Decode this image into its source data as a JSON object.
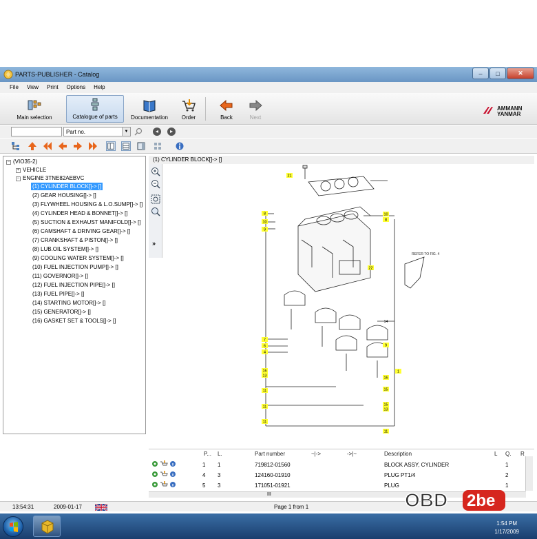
{
  "window": {
    "title": "PARTS-PUBLISHER - Catalog"
  },
  "menu": [
    "File",
    "View",
    "Print",
    "Options",
    "Help"
  ],
  "toolbar": {
    "main_selection": "Main selection",
    "catalogue": "Catalogue of parts",
    "documentation": "Documentation",
    "order": "Order",
    "back": "Back",
    "next": "Next"
  },
  "brand": {
    "line1": "AMMANN",
    "line2": "YANMAR"
  },
  "search": {
    "value": "",
    "field": "Part no."
  },
  "tree": {
    "root": "(VIO35-2)",
    "vehicle": "VEHICLE",
    "engine": "ENGINE 3TNE82AEBVC",
    "items": [
      "(1) CYLINDER BLOCK[]-> []",
      "(2) GEAR HOUSING[]-> []",
      "(3) FLYWHEEL HOUSING & L.O.SUMP[]-> []",
      "(4) CYLINDER HEAD & BONNET[]-> []",
      "(5) SUCTION & EXHAUST MANIFOLD[]-> []",
      "(6) CAMSHAFT & DRIVING GEAR[]-> []",
      "(7) CRANKSHAFT & PISTON[]-> []",
      "(8) LUB.OIL SYSTEM[]-> []",
      "(9) COOLING WATER SYSTEM[]-> []",
      "(10) FUEL INJECTION PUMP[]-> []",
      "(11) GOVERNOR[]-> []",
      "(12) FUEL INJECTION PIPE[]-> []",
      "(13) FUEL PIPE[]-> []",
      "(14) STARTING MOTOR[]-> []",
      "(15) GENERATOR[]-> []",
      "(16) GASKET SET & TOOLS[]-> []"
    ]
  },
  "pane": {
    "title": "(1) CYLINDER BLOCK[]-> []",
    "expand": "»"
  },
  "diagram": {
    "callouts_left": [
      "8",
      "10",
      "9",
      "7",
      "6",
      "4",
      "16",
      "13",
      "11",
      "11",
      "11"
    ],
    "callouts_right": [
      "22",
      "10",
      "8",
      "14",
      "9",
      "1",
      "16",
      "15",
      "15",
      "13",
      "11"
    ],
    "top": "21",
    "refer": "REFER TO FIG. 4"
  },
  "table": {
    "headers": [
      "P...",
      "L.",
      "Part number",
      "~|->",
      "->|~",
      "Description",
      "L",
      "Q.",
      "R"
    ],
    "rows": [
      {
        "p": "1",
        "l": "1",
        "part": "719812-01560",
        "desc": "BLOCK ASSY, CYLINDER",
        "q": "1"
      },
      {
        "p": "4",
        "l": "3",
        "part": "124160-01910",
        "desc": "PLUG PT1/4",
        "q": "2"
      },
      {
        "p": "5",
        "l": "3",
        "part": "171051-01921",
        "desc": "PLUG",
        "q": "1"
      }
    ],
    "hscroll_mark": "III"
  },
  "status": {
    "time": "13:54:31",
    "date": "2009-01-17",
    "page": "Page 1 from 1"
  },
  "taskbar": {
    "time": "1:54 PM",
    "date": "1/17/2009"
  },
  "watermark": {
    "part1": "OBD",
    "part2": "2be"
  },
  "colors": {
    "highlight": "#3399ff",
    "callout": "#ffff33",
    "titlebar": "#7fa7d1"
  }
}
